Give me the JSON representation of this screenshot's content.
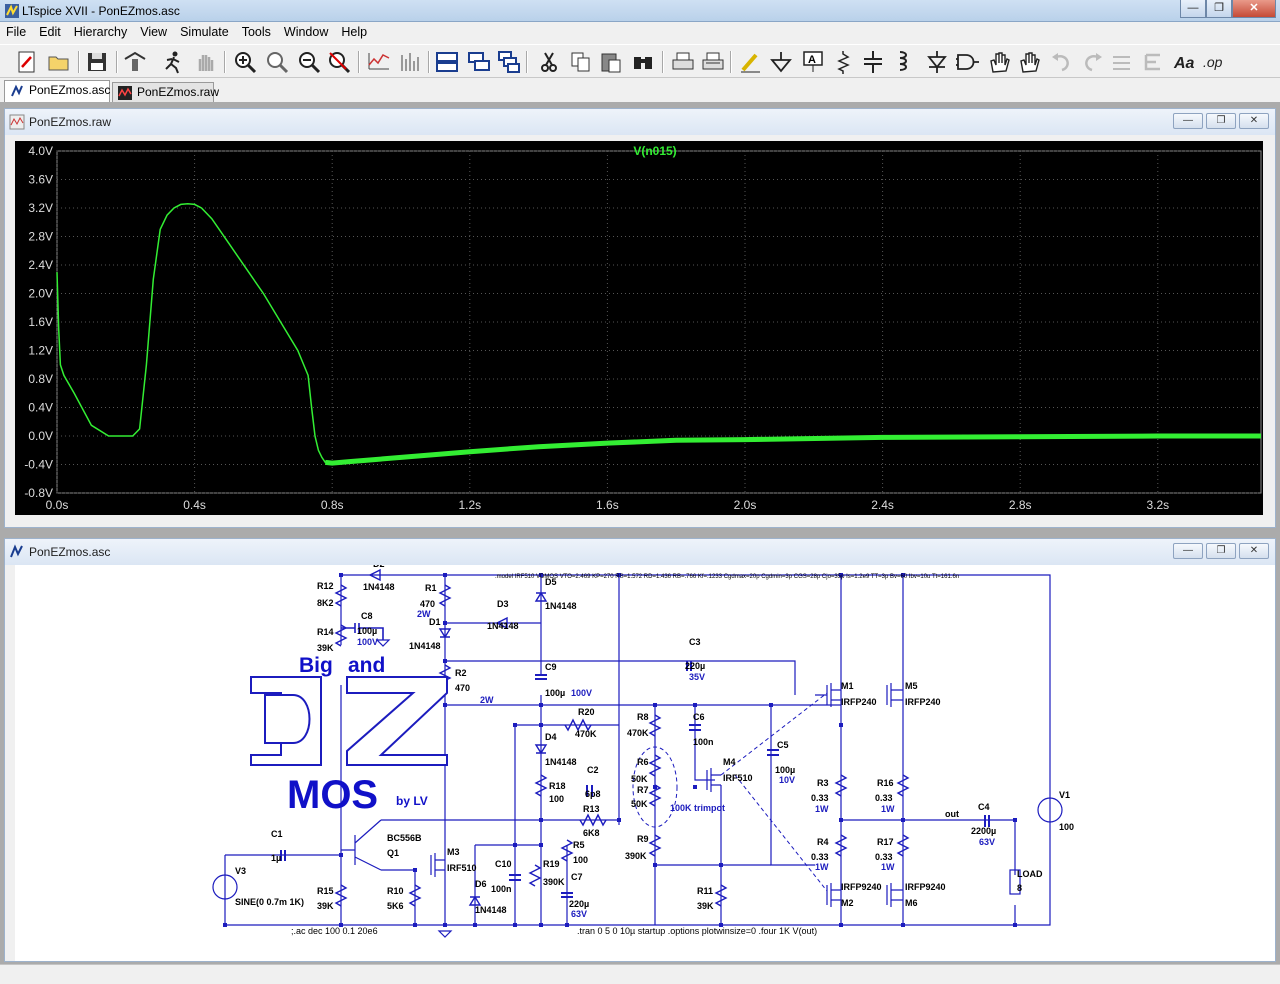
{
  "window": {
    "title": "LTspice XVII - PonEZmos.asc"
  },
  "titlebar_buttons": {
    "minimize": "—",
    "maximize": "❐",
    "close": "✕"
  },
  "menu": [
    "File",
    "Edit",
    "Hierarchy",
    "View",
    "Simulate",
    "Tools",
    "Window",
    "Help"
  ],
  "toolbar_icons": [
    "new-schematic-icon",
    "open-icon",
    "save-icon",
    "control-panel-icon",
    "run-icon",
    "halt-icon",
    "zoom-in-icon",
    "zoom-full-icon",
    "zoom-out-icon",
    "zoom-cancel-icon",
    "autorange-icon",
    "view-fft-icon",
    "tile-horizontal-icon",
    "tile-vertical-icon",
    "cascade-icon",
    "cut-icon",
    "copy-icon",
    "paste-icon",
    "find-icon",
    "print-icon",
    "print-setup-icon",
    "draw-wire-icon",
    "ground-icon",
    "label-net-icon",
    "resistor-icon",
    "capacitor-icon",
    "inductor-icon",
    "diode-icon",
    "component-icon",
    "move-icon",
    "drag-icon",
    "undo-icon",
    "redo-icon",
    "rotate-icon",
    "mirror-icon",
    "text-icon",
    "spice-directive-icon"
  ],
  "tabs": [
    {
      "label": "PonEZmos.asc",
      "active": true
    },
    {
      "label": "PonEZmos.raw",
      "active": false
    }
  ],
  "plot_window": {
    "title": "PonEZmos.raw"
  },
  "schematic_window": {
    "title": "PonEZmos.asc"
  },
  "chart_data": {
    "type": "line",
    "title": "V(n015)",
    "background": "#000000",
    "trace_color": "#33ee33",
    "grid": true,
    "xlim": [
      0,
      3.5
    ],
    "ylim": [
      -0.8,
      4.0
    ],
    "x_ticks": [
      "0.0s",
      "0.4s",
      "0.8s",
      "1.2s",
      "1.6s",
      "2.0s",
      "2.4s",
      "2.8s",
      "3.2s"
    ],
    "y_ticks": [
      "4.0V",
      "3.6V",
      "3.2V",
      "2.8V",
      "2.4V",
      "2.0V",
      "1.6V",
      "1.2V",
      "0.8V",
      "0.4V",
      "0.0V",
      "-0.4V",
      "-0.8V"
    ],
    "series": [
      {
        "name": "V(n015)",
        "x": [
          0.0,
          0.005,
          0.01,
          0.02,
          0.05,
          0.1,
          0.15,
          0.18,
          0.2,
          0.22,
          0.24,
          0.26,
          0.28,
          0.3,
          0.32,
          0.34,
          0.36,
          0.38,
          0.4,
          0.42,
          0.45,
          0.5,
          0.55,
          0.6,
          0.65,
          0.7,
          0.73,
          0.74,
          0.75,
          0.76,
          0.77,
          0.78,
          0.8,
          0.85,
          0.9,
          1.0,
          1.2,
          1.4,
          1.6,
          1.8,
          2.0,
          2.4,
          2.8,
          3.2,
          3.5
        ],
        "y": [
          2.3,
          1.5,
          1.0,
          0.85,
          0.6,
          0.15,
          0.0,
          0.0,
          0.0,
          0.0,
          0.1,
          1.0,
          2.2,
          2.9,
          3.1,
          3.2,
          3.25,
          3.26,
          3.25,
          3.2,
          3.05,
          2.7,
          2.35,
          2.0,
          1.6,
          1.2,
          0.85,
          0.4,
          0.0,
          -0.2,
          -0.3,
          -0.37,
          -0.38,
          -0.36,
          -0.34,
          -0.3,
          -0.22,
          -0.15,
          -0.1,
          -0.06,
          -0.05,
          -0.02,
          -0.01,
          0.0,
          0.0
        ]
      }
    ]
  },
  "schematic": {
    "directive_model": ".model IRF510 VDMOS VTO=2.469 KP=270 RS=1.572 RD=1.436 RB=.766 Kf=.1233 Cgdmax=20p Cgdmin=3p CGS=28p Cjo=35p Is=1.2e9 TT=3p Bv=60 Ibv=10u Tt=161.6n",
    "directive_ac": ";.ac dec 100 0.1 20e6",
    "directive_tran": ".tran 0 5 0 10µ startup  .options plotwinsize=0 .four 1K V(out)",
    "logo_line1": "Big",
    "logo_line2": "and",
    "logo_main": "MOS",
    "logo_by": "by LV",
    "trimpot_label": "100K trimpot",
    "out_label": "out",
    "labels": [
      {
        "id": "R12",
        "text": "R12"
      },
      {
        "id": "R12v",
        "text": "8K2"
      },
      {
        "id": "R14",
        "text": "R14"
      },
      {
        "id": "R14v",
        "text": "39K"
      },
      {
        "id": "C8",
        "text": "C8"
      },
      {
        "id": "C8v",
        "text": "100µ"
      },
      {
        "id": "C8w",
        "text": "100V"
      },
      {
        "id": "D2",
        "text": "D2"
      },
      {
        "id": "D2v",
        "text": "1N4148"
      },
      {
        "id": "R1",
        "text": "R1"
      },
      {
        "id": "R1v",
        "text": "470"
      },
      {
        "id": "R1w",
        "text": "2W"
      },
      {
        "id": "D1",
        "text": "D1"
      },
      {
        "id": "D1v",
        "text": "1N4148"
      },
      {
        "id": "D3",
        "text": "D3"
      },
      {
        "id": "D3v",
        "text": "1N4148"
      },
      {
        "id": "D5",
        "text": "D5"
      },
      {
        "id": "D5v",
        "text": "1N4148"
      },
      {
        "id": "R2",
        "text": "R2"
      },
      {
        "id": "R2v",
        "text": "470"
      },
      {
        "id": "R2w",
        "text": "2W"
      },
      {
        "id": "C9",
        "text": "C9"
      },
      {
        "id": "C9v",
        "text": "100µ"
      },
      {
        "id": "C9w",
        "text": "100V"
      },
      {
        "id": "C3",
        "text": "C3"
      },
      {
        "id": "C3v",
        "text": "220µ"
      },
      {
        "id": "C3w",
        "text": "35V"
      },
      {
        "id": "R20",
        "text": "R20"
      },
      {
        "id": "R20v",
        "text": "470K"
      },
      {
        "id": "D4",
        "text": "D4"
      },
      {
        "id": "D4v",
        "text": "1N4148"
      },
      {
        "id": "R8",
        "text": "R8"
      },
      {
        "id": "R8v",
        "text": "470K"
      },
      {
        "id": "C6",
        "text": "C6"
      },
      {
        "id": "C6v",
        "text": "100n"
      },
      {
        "id": "C5",
        "text": "C5"
      },
      {
        "id": "C5v",
        "text": "100µ"
      },
      {
        "id": "C5w",
        "text": "10V"
      },
      {
        "id": "M1",
        "text": "M1"
      },
      {
        "id": "M1v",
        "text": "IRFP240"
      },
      {
        "id": "M5",
        "text": "M5"
      },
      {
        "id": "M5v",
        "text": "IRFP240"
      },
      {
        "id": "M4",
        "text": "M4"
      },
      {
        "id": "M4v",
        "text": "IRF510"
      },
      {
        "id": "R18",
        "text": "R18"
      },
      {
        "id": "R18v",
        "text": "100"
      },
      {
        "id": "C2",
        "text": "C2"
      },
      {
        "id": "C2v",
        "text": "6p8"
      },
      {
        "id": "R13",
        "text": "R13"
      },
      {
        "id": "R13v",
        "text": "6K8"
      },
      {
        "id": "R6",
        "text": "R6"
      },
      {
        "id": "R6v",
        "text": "50K"
      },
      {
        "id": "R7",
        "text": "R7"
      },
      {
        "id": "R7v",
        "text": "50K"
      },
      {
        "id": "R3",
        "text": "R3"
      },
      {
        "id": "R3v",
        "text": "0.33"
      },
      {
        "id": "R3w",
        "text": "1W"
      },
      {
        "id": "R16",
        "text": "R16"
      },
      {
        "id": "R16v",
        "text": "0.33"
      },
      {
        "id": "R16w",
        "text": "1W"
      },
      {
        "id": "V1",
        "text": "V1"
      },
      {
        "id": "V1v",
        "text": "100"
      },
      {
        "id": "C4",
        "text": "C4"
      },
      {
        "id": "C4v",
        "text": "2200µ"
      },
      {
        "id": "C4w",
        "text": "63V"
      },
      {
        "id": "R4",
        "text": "R4"
      },
      {
        "id": "R4v",
        "text": "0.33"
      },
      {
        "id": "R4w",
        "text": "1W"
      },
      {
        "id": "R17",
        "text": "R17"
      },
      {
        "id": "R17v",
        "text": "0.33"
      },
      {
        "id": "R17w",
        "text": "1W"
      },
      {
        "id": "LOAD",
        "text": "LOAD"
      },
      {
        "id": "LOADv",
        "text": "8"
      },
      {
        "id": "C1",
        "text": "C1"
      },
      {
        "id": "C1v",
        "text": "1µ"
      },
      {
        "id": "BC",
        "text": "BC556B"
      },
      {
        "id": "Q1",
        "text": "Q1"
      },
      {
        "id": "M3",
        "text": "M3"
      },
      {
        "id": "M3v",
        "text": "IRF510"
      },
      {
        "id": "R5",
        "text": "R5"
      },
      {
        "id": "R5v",
        "text": "100"
      },
      {
        "id": "R9",
        "text": "R9"
      },
      {
        "id": "R9v",
        "text": "390K"
      },
      {
        "id": "C10",
        "text": "C10"
      },
      {
        "id": "C10v",
        "text": "100n"
      },
      {
        "id": "R19",
        "text": "R19"
      },
      {
        "id": "R19v",
        "text": "390K"
      },
      {
        "id": "C7",
        "text": "C7"
      },
      {
        "id": "C7v",
        "text": "220µ"
      },
      {
        "id": "C7w",
        "text": "63V"
      },
      {
        "id": "D6",
        "text": "D6"
      },
      {
        "id": "D6v",
        "text": "1N4148"
      },
      {
        "id": "R10",
        "text": "R10"
      },
      {
        "id": "R10v",
        "text": "5K6"
      },
      {
        "id": "R15",
        "text": "R15"
      },
      {
        "id": "R15v",
        "text": "39K"
      },
      {
        "id": "V3",
        "text": "V3"
      },
      {
        "id": "V3v",
        "text": "SINE(0 0.7m 1K)"
      },
      {
        "id": "R11",
        "text": "R11"
      },
      {
        "id": "R11v",
        "text": "39K"
      },
      {
        "id": "M2",
        "text": "M2"
      },
      {
        "id": "M2v",
        "text": "IRFP9240"
      },
      {
        "id": "M6",
        "text": "M6"
      },
      {
        "id": "M6v",
        "text": "IRFP9240"
      }
    ]
  }
}
